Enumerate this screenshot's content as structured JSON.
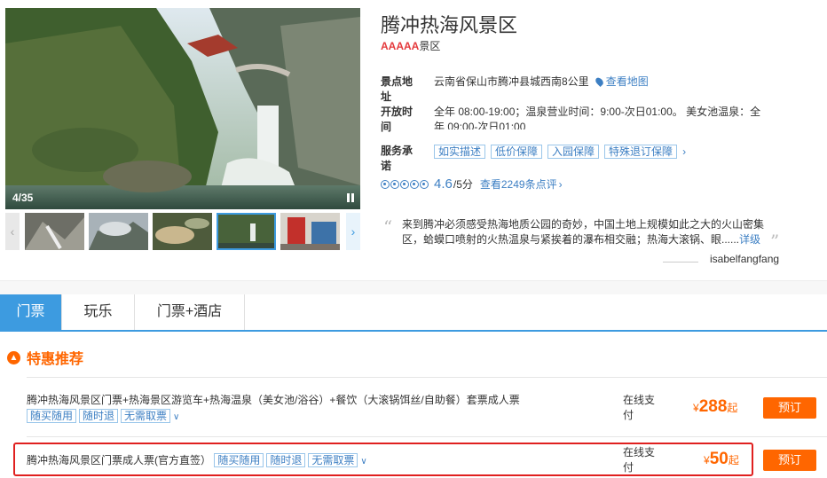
{
  "gallery": {
    "counter": "4/35"
  },
  "header": {
    "title": "腾冲热海风景区",
    "grade_stars": "AAAAA",
    "grade_label": "景区"
  },
  "info": {
    "address_label": "景点地址",
    "address": "云南省保山市腾冲县城西南8公里",
    "map_link": "查看地图",
    "hours_label": "开放时间",
    "hours": "全年 08:00-19:00；温泉营业时间：9:00-次日01:00。 美女池温泉：全年 09:00-次日01:00",
    "service_label": "服务承诺",
    "service_tags": [
      "如实描述",
      "低价保障",
      "入园保障",
      "特殊退订保障"
    ],
    "score": "4.6",
    "score_of": "/5分",
    "reviews_link": "查看2249条点评"
  },
  "quote": {
    "text": "来到腾冲必须感受热海地质公园的奇妙，中国土地上规模如此之大的火山密集区，蛤蟆口喷射的火热温泉与紧挨着的瀑布相交融；热海大滚锅、眼......",
    "more": "详级",
    "author": "isabelfangfang"
  },
  "tabs": [
    "门票",
    "玩乐",
    "门票+酒店"
  ],
  "section": {
    "title": "特惠推荐"
  },
  "products": [
    {
      "name": "腾冲热海风景区门票+热海景区游览车+热海温泉（美女池/浴谷）+餐饮（大滚锅饵丝/自助餐）套票成人票",
      "tags": [
        "随买随用",
        "随时退",
        "无需取票"
      ],
      "pay": "在线支付",
      "currency": "¥",
      "price": "288",
      "price_suffix": "起",
      "button": "预订"
    },
    {
      "name": "腾冲热海风景区门票成人票(官方直签）",
      "tags": [
        "随买随用",
        "随时退",
        "无需取票"
      ],
      "pay": "在线支付",
      "currency": "¥",
      "price": "50",
      "price_suffix": "起",
      "button": "预订"
    }
  ],
  "colors": {
    "accent": "#3d9be0",
    "orange": "#ff6600",
    "highlight": "#e0201f"
  }
}
